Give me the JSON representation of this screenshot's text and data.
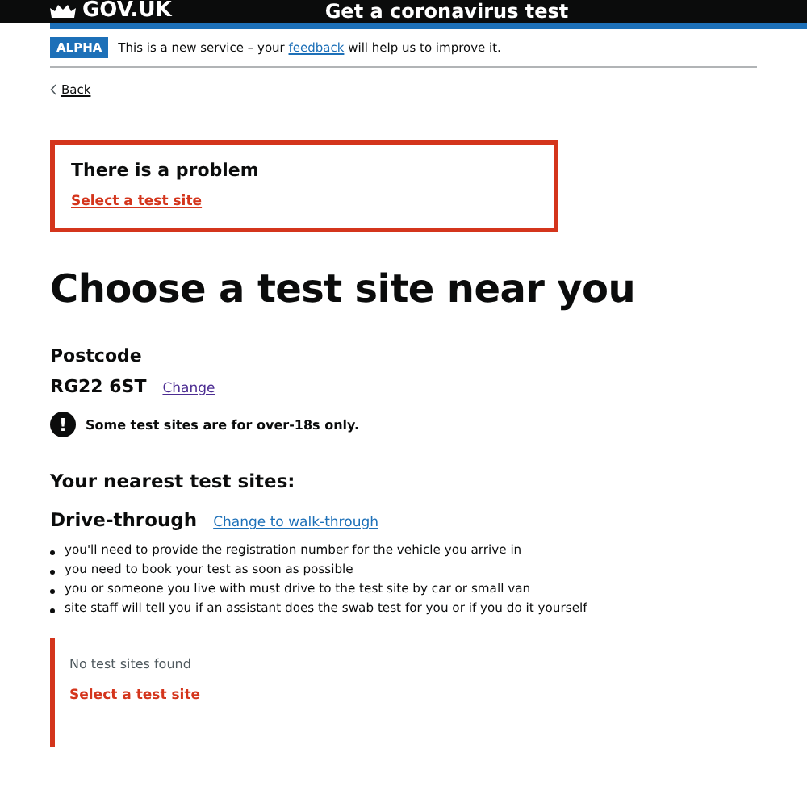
{
  "header": {
    "logo": "GOV.UK",
    "service": "Get a coronavirus test"
  },
  "phase_banner": {
    "tag": "ALPHA",
    "text_before": "This is a new service – your",
    "link": "feedback",
    "text_after": "will help us to improve it."
  },
  "back_link": "Back",
  "error_summary": {
    "title": "There is a problem",
    "links": [
      "Select a test site"
    ]
  },
  "heading": "Choose a test site near you",
  "postcode": {
    "label": "Postcode",
    "value": "RG22 6ST",
    "change": "Change"
  },
  "warning": {
    "icon": "!",
    "text": "Some test sites are for over-18s only."
  },
  "nearest_title": "Your nearest test sites:",
  "site_type": {
    "title": "Drive-through",
    "change": "Change to walk-through"
  },
  "bullets": [
    "you'll need to provide the registration number for the vehicle you arrive in",
    "you need to book your test as soon as possible",
    "you or someone you live with must drive to the test site by car or small van",
    "site staff will tell you if an assistant does the swab test for you or if you do it yourself"
  ],
  "error_group": {
    "message": "No test sites found",
    "error": "Select a test site"
  }
}
